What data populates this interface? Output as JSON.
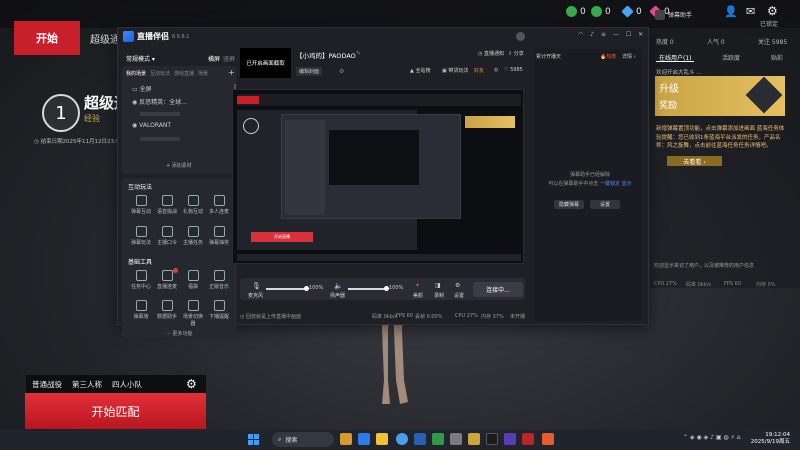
{
  "game": {
    "start_tab": "开始",
    "mode_tab": "超级通",
    "resources": [
      {
        "value": "0",
        "color": "#3aa84d"
      },
      {
        "value": "0",
        "color": "#3aa84d"
      },
      {
        "value": "0",
        "color": "#4aa6f0"
      },
      {
        "value": "0",
        "color": "#e0488f"
      }
    ],
    "rank_number": "1",
    "rank_title": "超级通",
    "rank_sub": "经验",
    "season_end": "结束日期2025年11月12日23:59:59",
    "match_options": [
      "普通战役",
      "第三人称",
      "四人小队"
    ],
    "match_button": "开始匹配",
    "right": {
      "header_title": "弹幕助手",
      "header_sub": "已锁定",
      "stats": [
        "热度 0",
        "人气 0",
        "关注 5985"
      ],
      "tabs": [
        "在线用户(1)",
        "活跃度",
        "贴彩"
      ],
      "notice_line": "欢迎开启大乱斗 ...",
      "upgrade_card_line1": "升级",
      "upgrade_card_line2": "奖励",
      "notice": "新增弹幕置顶功能，点击弹幕添加进画面 蓝海任务体验提醒：您已收到1条蓝海平台派发的任务，产品名称：风之旋舞，点击前往蓝海任务任务详情吧。",
      "notice_button": "去看看 ›",
      "empty_tip": "欢迎显示来访了用户，以及被推荐的用户信息",
      "footer_stats": [
        "CPU 27%",
        "码率 0kb/s",
        "FPS 60",
        "内存 0%"
      ]
    }
  },
  "streamer": {
    "app_name": "直播伴侣",
    "version": "6.5.6.1",
    "mode_label": "常规模式",
    "orientation": [
      "横屏",
      "竖屏"
    ],
    "scene_tabs": [
      "我的场景",
      "互动玩法",
      "游戏直播",
      "场景"
    ],
    "scenes": [
      "全屏",
      "反恐精英：全球...",
      "",
      "VALORANT",
      ""
    ],
    "add_material": "+ 添加素材",
    "interactive_title": "互动玩法",
    "interactive_tools": [
      [
        "弹幕互动",
        "语音挑战",
        "礼物互动",
        "多人连麦"
      ],
      [
        "弹幕玩法",
        "主播口令",
        "主播任务",
        "弹幕抽奖"
      ]
    ],
    "basic_title": "基础工具",
    "basic_tools": [
      [
        "任务中心",
        "直播连麦",
        "福袋",
        "正版音乐"
      ],
      [
        "弹幕墙",
        "数据助手",
        "场景切换器",
        "下播提醒"
      ]
    ],
    "more_features": "··· 更多功能",
    "cover_box": "已开启画面截取",
    "stream_title": "【小鸡的】PAODAO",
    "edit_cover": "编辑封面",
    "top_actions": [
      "直播通知",
      "分享"
    ],
    "sub_actions": [
      "全站榜",
      "带货玩法",
      "好友"
    ],
    "online_label": "5985",
    "mic_label": "麦克风",
    "speaker_label": "扬声器",
    "mic_percent": "100%",
    "speaker_percent": "100%",
    "ctrl_buttons": [
      "美颜",
      "录制",
      "设置"
    ],
    "live_button": "连接中...",
    "footer_left": "回放就是上传直播中画面",
    "footer_stats": [
      "码率 0kb/s",
      "FPS 60",
      "丢帧 0.00%",
      "CPU 27%",
      "内存 37%",
      "未开播"
    ],
    "right_panel_title": "累计开播天",
    "right_badge": "热度",
    "right_detail": "详情 ›",
    "preview_button": "开始直播",
    "bullet_tip_line1": "弹幕助手已经解除",
    "bullet_tip_line2": "可以在弹幕助手中点击",
    "bullet_tip_links": [
      "一键锁定",
      "显示"
    ],
    "bullet_buttons": [
      "隐藏弹幕",
      "设置"
    ]
  },
  "taskbar": {
    "search_placeholder": "搜索",
    "time": "19:12:04",
    "date": "2025/9/19周五",
    "icon_colors": [
      "#2d7be5",
      "#d89a2c",
      "#46a1e8",
      "#2f9a4a",
      "#d2383d",
      "#f0c23a",
      "#1b1b1b",
      "#b8262c",
      "#5a3db5",
      "#e85b2a",
      "#7b7b7b"
    ]
  },
  "colors": {
    "accent_red": "#c8202a",
    "accent_blue": "#2f7df6",
    "gold": "#c9a85a"
  }
}
